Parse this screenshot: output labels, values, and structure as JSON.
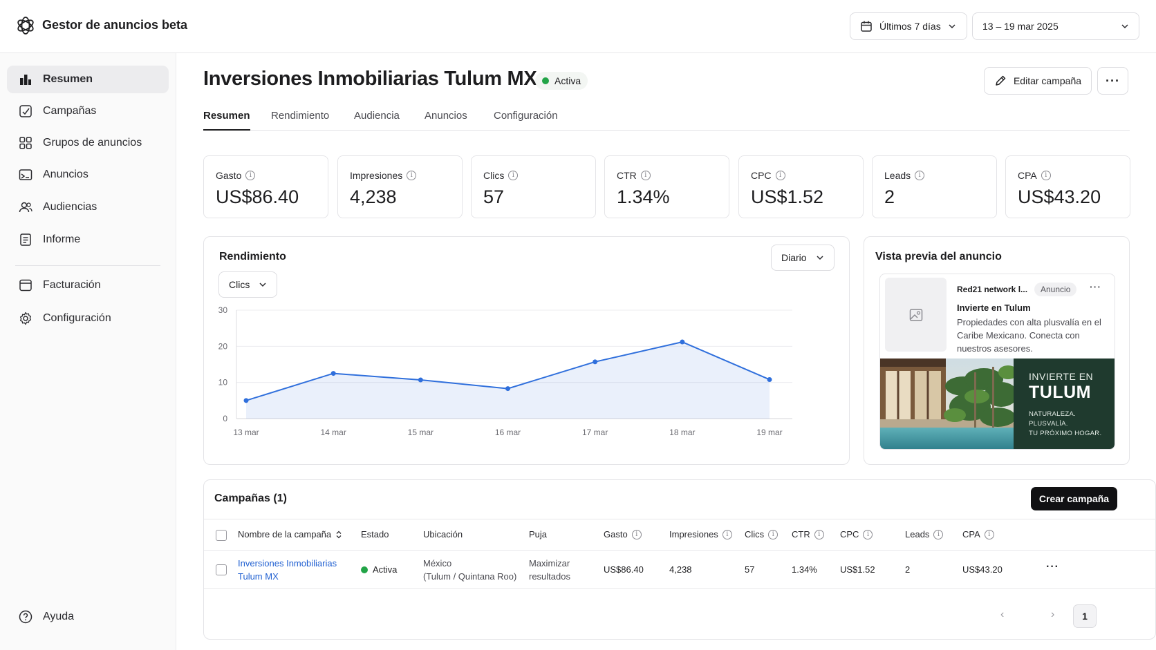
{
  "app": {
    "title": "Gestor de anuncios beta"
  },
  "header": {
    "range_label": "Últimos 7 días",
    "date_label": "13 – 19 mar 2025"
  },
  "sidebar": {
    "items": [
      {
        "label": "Resumen",
        "icon": "bar-chart-icon"
      },
      {
        "label": "Campañas",
        "icon": "campaign-icon"
      },
      {
        "label": "Grupos de anuncios",
        "icon": "grid-icon"
      },
      {
        "label": "Anuncios",
        "icon": "image-icon"
      },
      {
        "label": "Audiencias",
        "icon": "users-icon"
      },
      {
        "label": "Informe",
        "icon": "document-icon"
      },
      {
        "label": "Facturación",
        "icon": "billing-icon"
      },
      {
        "label": "Configuración",
        "icon": "gear-icon"
      }
    ],
    "help_label": "Ayuda"
  },
  "campaign": {
    "title": "Inversiones Inmobiliarias Tulum MX",
    "status": "Activa",
    "status_color": "#22a447",
    "edit_label": "Editar campaña",
    "more_label": "···"
  },
  "tabs": [
    "Resumen",
    "Rendimiento",
    "Audiencia",
    "Anuncios",
    "Configuración"
  ],
  "kpis": [
    {
      "label": "Gasto",
      "value": "US$86.40"
    },
    {
      "label": "Impresiones",
      "value": "4,238"
    },
    {
      "label": "Clics",
      "value": "57"
    },
    {
      "label": "CTR",
      "value": "1.34%"
    },
    {
      "label": "CPC",
      "value": "US$1.52"
    },
    {
      "label": "Leads",
      "value": "2"
    },
    {
      "label": "CPA",
      "value": "US$43.20"
    }
  ],
  "performance": {
    "title": "Rendimiento",
    "granularity": "Diario",
    "metric": "Clics"
  },
  "chart_data": {
    "type": "area",
    "categories": [
      "13 mar",
      "14 mar",
      "15 mar",
      "16 mar",
      "17 mar",
      "18 mar",
      "19 mar"
    ],
    "series": [
      {
        "name": "Clics",
        "values": [
          5,
          12.5,
          10.7,
          8.3,
          15.7,
          21.2,
          10.8
        ]
      }
    ],
    "ylim": [
      0,
      30
    ],
    "yticks": [
      "0",
      "10",
      "20",
      "30"
    ],
    "grid": true,
    "color": "#2f6fdc"
  },
  "preview": {
    "title": "Vista previa del anuncio",
    "page_name": "Red21 network l...",
    "badge": "Anuncio",
    "headline": "Invierte en Tulum",
    "body": "Propiedades con alta plusvalía en el Caribe Mexicano. Conecta con nuestros asesores.",
    "overlay_line1": "INVIERTE EN",
    "overlay_line2": "TULUM",
    "overlay_line3": "NATURALEZA.",
    "overlay_line4": "PLUSVALÍA.",
    "overlay_line5": "TU PRÓXIMO HOGAR."
  },
  "campaigns": {
    "title": "Campañas (1)",
    "create_label": "Crear campaña",
    "columns": [
      "Nombre de la campaña",
      "Estado",
      "Ubicación",
      "Puja",
      "Gasto",
      "Impresiones",
      "Clics",
      "CTR",
      "CPC",
      "Leads",
      "CPA"
    ],
    "rows": [
      {
        "name_line1": "Inversiones Inmobiliarias",
        "name_line2": "Tulum MX",
        "status": "Activa",
        "location_line1": "México",
        "location_line2": "(Tulum / Quintana Roo)",
        "bid_line1": "Maximizar",
        "bid_line2": "resultados",
        "spend": "US$86.40",
        "impressions": "4,238",
        "clicks": "57",
        "ctr": "1.34%",
        "cpc": "US$1.52",
        "leads": "2",
        "cpa": "US$43.20"
      }
    ],
    "page": "1"
  }
}
